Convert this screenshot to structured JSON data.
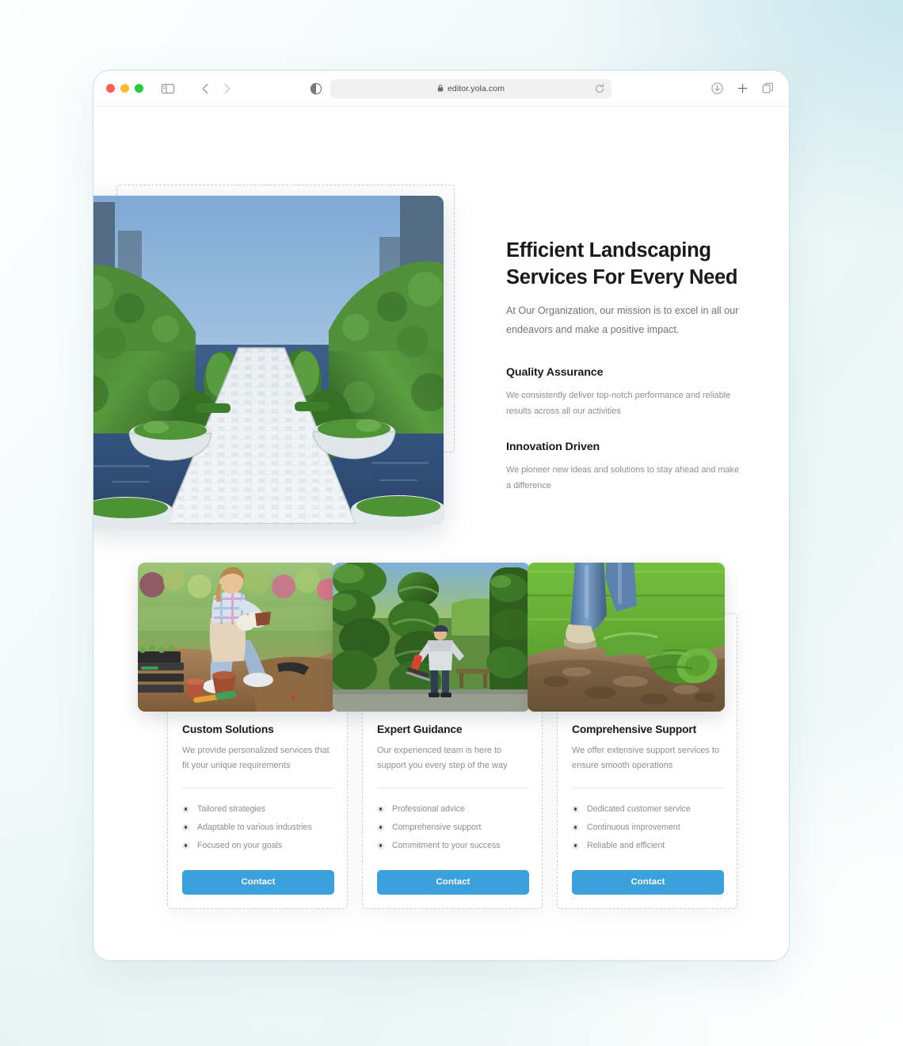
{
  "browser": {
    "url": "editor.yola.com",
    "icons": {
      "lock": "lock-icon",
      "reload": "reload-icon",
      "sidebar": "sidebar-toggle-icon",
      "back": "back-chevron-icon",
      "forward": "forward-chevron-icon",
      "reader": "reader-view-icon",
      "download": "download-icon",
      "new_tab": "plus-icon",
      "tabs": "tab-overview-icon"
    },
    "traffic_lights": {
      "close": "#ff5f57",
      "minimize": "#febc2e",
      "maximize": "#28c840"
    }
  },
  "hero": {
    "title": "Efficient Landscaping Services For Every Need",
    "subtitle": "At Our Organization, our mission is to excel in all our endeavors and make a positive impact.",
    "image_alt": "formal-garden-walkway-image",
    "features": [
      {
        "title": "Quality Assurance",
        "body": "We consistently deliver top-notch performance and reliable results across all our activities"
      },
      {
        "title": "Innovation Driven",
        "body": "We pioneer new ideas and solutions to stay ahead and make a difference"
      }
    ]
  },
  "cards": [
    {
      "title": "Custom Solutions",
      "description": "We provide personalized services that fit your unique requirements",
      "image_alt": "gardener-planting-flowers-image",
      "bullets": [
        "Tailored strategies",
        "Adaptable to various industries",
        "Focused on your goals"
      ],
      "button": "Contact"
    },
    {
      "title": "Expert Guidance",
      "description": "Our experienced team is here to support you every step of the way",
      "image_alt": "worker-trimming-hedge-image",
      "bullets": [
        "Professional advice",
        "Comprehensive support",
        "Commitment to your success"
      ],
      "button": "Contact"
    },
    {
      "title": "Comprehensive Support",
      "description": "We offer extensive support services to ensure smooth operations",
      "image_alt": "laying-sod-turf-image",
      "bullets": [
        "Dedicated customer service",
        "Continuous improvement",
        "Reliable and efficient"
      ],
      "button": "Contact"
    }
  ],
  "colors": {
    "accent": "#3ba1dd",
    "heading": "#1a1a1a",
    "body_text": "#8b8f94",
    "window_border": "#c3e1ec",
    "dashed_outline": "#cfcfcf"
  }
}
